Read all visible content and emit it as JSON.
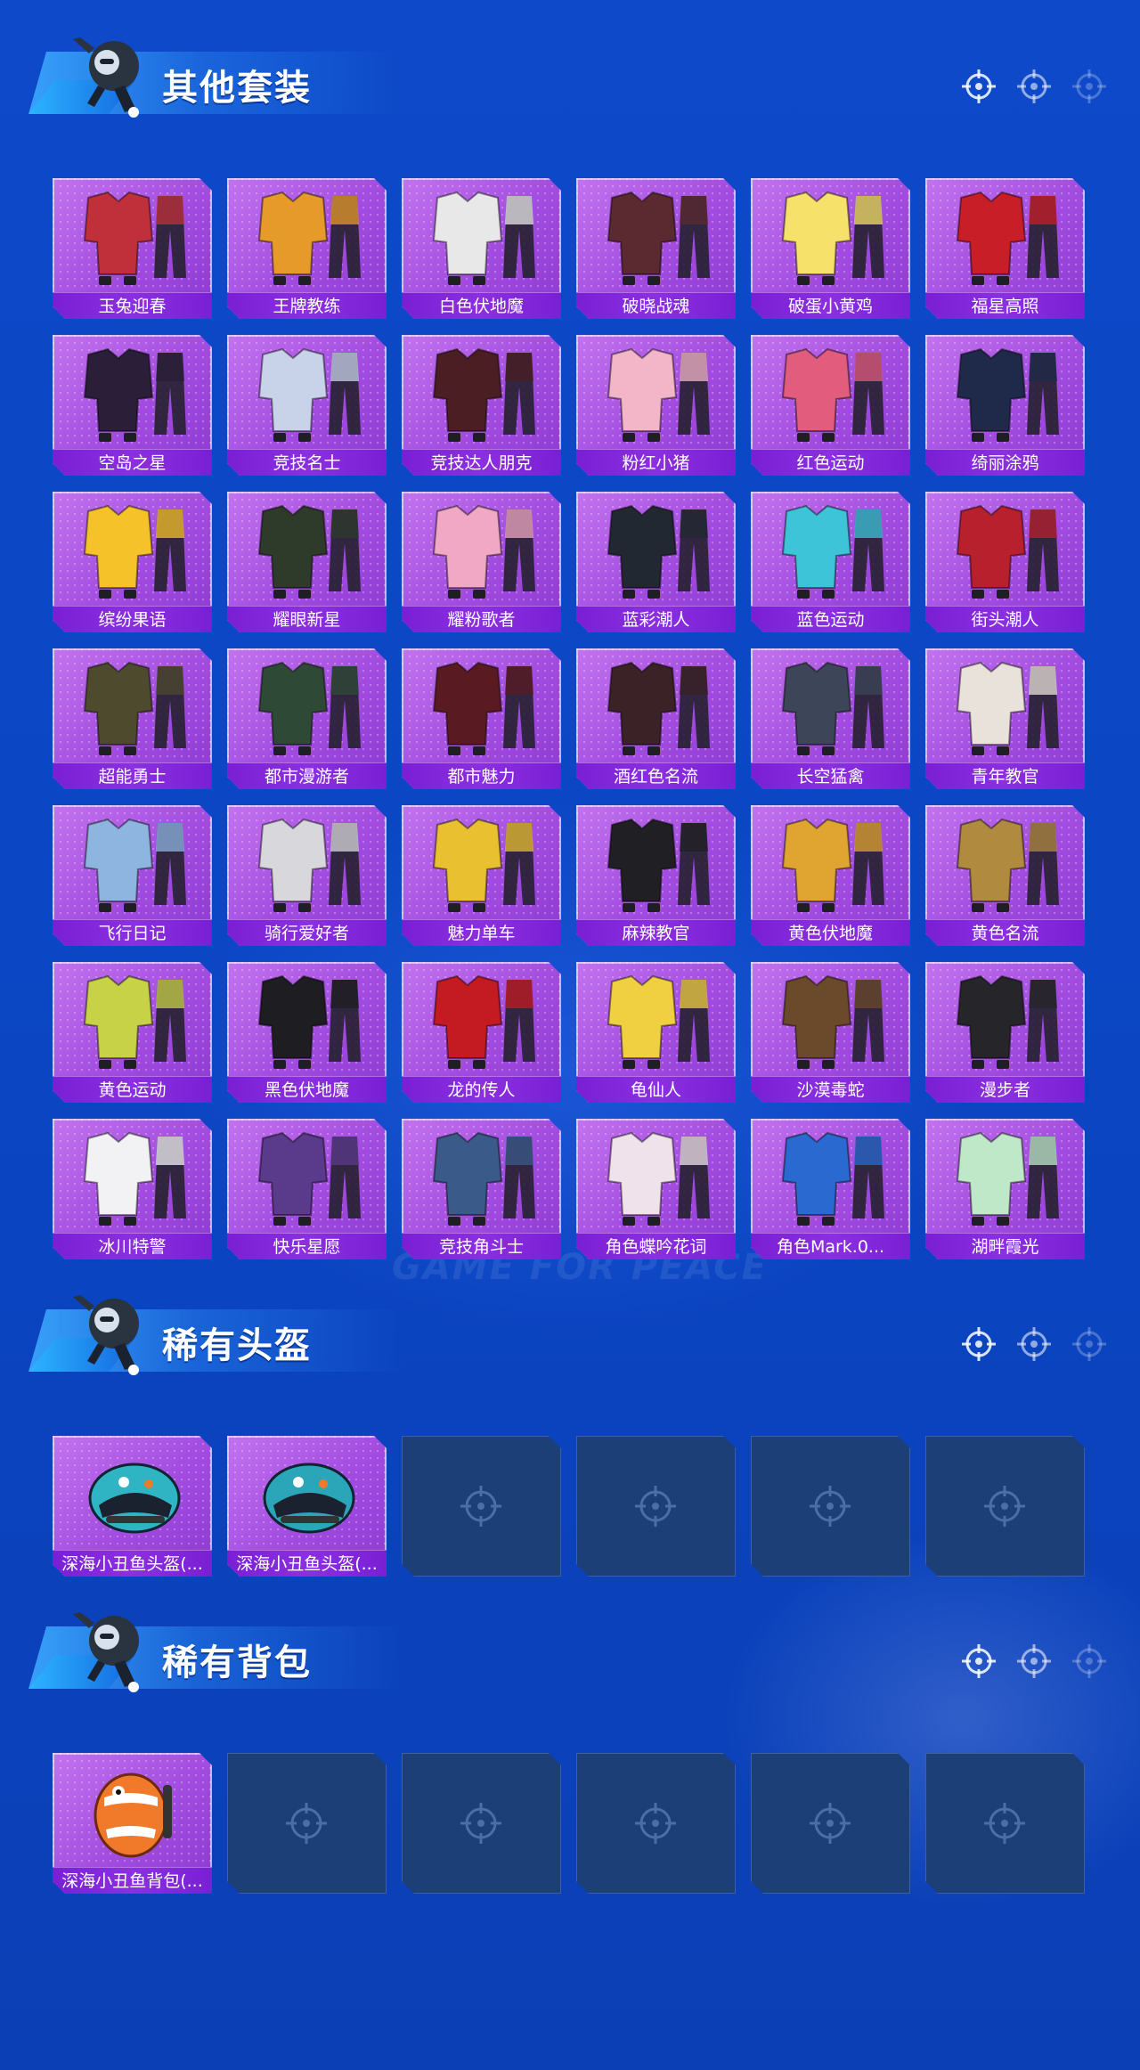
{
  "sections": [
    {
      "title": "其他套装",
      "items": [
        {
          "label": "玉兔迎春",
          "icon": "outfit-icon",
          "color": "#c0303a"
        },
        {
          "label": "王牌教练",
          "icon": "outfit-icon",
          "color": "#e69a2a"
        },
        {
          "label": "白色伏地魔",
          "icon": "outfit-icon",
          "color": "#e8e8e8"
        },
        {
          "label": "破晓战魂",
          "icon": "outfit-icon",
          "color": "#5a2a30"
        },
        {
          "label": "破蛋小黄鸡",
          "icon": "outfit-icon",
          "color": "#f6e16a"
        },
        {
          "label": "福星高照",
          "icon": "outfit-icon",
          "color": "#c81e28"
        },
        {
          "label": "空岛之星",
          "icon": "outfit-icon",
          "color": "#2a1e38"
        },
        {
          "label": "竞技名士",
          "icon": "outfit-icon",
          "color": "#c8d2e8"
        },
        {
          "label": "竞技达人朋克",
          "icon": "outfit-icon",
          "color": "#4a1e22"
        },
        {
          "label": "粉红小猪",
          "icon": "outfit-icon",
          "color": "#f3b6c8"
        },
        {
          "label": "红色运动",
          "icon": "outfit-icon",
          "color": "#e25c7e"
        },
        {
          "label": "绮丽涂鸦",
          "icon": "outfit-icon",
          "color": "#1f2a4a"
        },
        {
          "label": "缤纷果语",
          "icon": "outfit-icon",
          "color": "#f6c22a"
        },
        {
          "label": "耀眼新星",
          "icon": "outfit-icon",
          "color": "#2e3a2a"
        },
        {
          "label": "耀粉歌者",
          "icon": "outfit-icon",
          "color": "#f0a8c4"
        },
        {
          "label": "蓝彩潮人",
          "icon": "outfit-icon",
          "color": "#222831"
        },
        {
          "label": "蓝色运动",
          "icon": "outfit-icon",
          "color": "#3ec4d8"
        },
        {
          "label": "街头潮人",
          "icon": "outfit-icon",
          "color": "#b8202e"
        },
        {
          "label": "超能勇士",
          "icon": "outfit-icon",
          "color": "#4e4a2e"
        },
        {
          "label": "都市漫游者",
          "icon": "outfit-icon",
          "color": "#2e4a36"
        },
        {
          "label": "都市魅力",
          "icon": "outfit-icon",
          "color": "#5a1a22"
        },
        {
          "label": "酒红色名流",
          "icon": "outfit-icon",
          "color": "#3a2226"
        },
        {
          "label": "长空猛禽",
          "icon": "outfit-icon",
          "color": "#3c4658"
        },
        {
          "label": "青年教官",
          "icon": "outfit-icon",
          "color": "#e8e2da"
        },
        {
          "label": "飞行日记",
          "icon": "outfit-icon",
          "color": "#8eb4e0"
        },
        {
          "label": "骑行爱好者",
          "icon": "outfit-icon",
          "color": "#d8d8dc"
        },
        {
          "label": "魅力单车",
          "icon": "outfit-icon",
          "color": "#e8c030"
        },
        {
          "label": "麻辣教官",
          "icon": "outfit-icon",
          "color": "#202024"
        },
        {
          "label": "黄色伏地魔",
          "icon": "outfit-icon",
          "color": "#e0a430"
        },
        {
          "label": "黄色名流",
          "icon": "outfit-icon",
          "color": "#b08a3e"
        },
        {
          "label": "黄色运动",
          "icon": "outfit-icon",
          "color": "#c8d246"
        },
        {
          "label": "黑色伏地魔",
          "icon": "outfit-icon",
          "color": "#1e1e22"
        },
        {
          "label": "龙的传人",
          "icon": "outfit-icon",
          "color": "#c41a22"
        },
        {
          "label": "龟仙人",
          "icon": "outfit-icon",
          "color": "#f0d040"
        },
        {
          "label": "沙漠毒蛇",
          "icon": "outfit-icon",
          "color": "#6a4a2a"
        },
        {
          "label": "漫步者",
          "icon": "outfit-icon",
          "color": "#26262a"
        },
        {
          "label": "冰川特警",
          "icon": "outfit-icon",
          "color": "#f2f2f4"
        },
        {
          "label": "快乐星愿",
          "icon": "outfit-icon",
          "color": "#5a3a8a"
        },
        {
          "label": "竞技角斗士",
          "icon": "outfit-icon",
          "color": "#3a5a8a"
        },
        {
          "label": "角色蝶吟花词",
          "icon": "outfit-icon",
          "color": "#f0e2ea"
        },
        {
          "label": "角色Mark.0...",
          "icon": "outfit-icon",
          "color": "#2a6ad0"
        },
        {
          "label": "湖畔霞光",
          "icon": "outfit-icon",
          "color": "#bfe8c8"
        }
      ]
    },
    {
      "title": "稀有头盔",
      "items": [
        {
          "label": "深海小丑鱼头盔(...",
          "icon": "helmet-icon",
          "color": "#2fb4c4"
        },
        {
          "label": "深海小丑鱼头盔(...",
          "icon": "helmet-icon",
          "color": "#2aa6b8"
        },
        {
          "label": "",
          "icon": "empty-slot",
          "color": ""
        },
        {
          "label": "",
          "icon": "empty-slot",
          "color": ""
        },
        {
          "label": "",
          "icon": "empty-slot",
          "color": ""
        },
        {
          "label": "",
          "icon": "empty-slot",
          "color": ""
        }
      ]
    },
    {
      "title": "稀有背包",
      "items": [
        {
          "label": "深海小丑鱼背包(...",
          "icon": "backpack-icon",
          "color": "#f07a2a"
        },
        {
          "label": "",
          "icon": "empty-slot",
          "color": ""
        },
        {
          "label": "",
          "icon": "empty-slot",
          "color": ""
        },
        {
          "label": "",
          "icon": "empty-slot",
          "color": ""
        },
        {
          "label": "",
          "icon": "empty-slot",
          "color": ""
        },
        {
          "label": "",
          "icon": "empty-slot",
          "color": ""
        }
      ]
    }
  ],
  "theme": {
    "background": "#0b46c4",
    "card": "#a24be0",
    "label_bar": "#7a1fd4",
    "empty_slot": "#1d3f77"
  }
}
